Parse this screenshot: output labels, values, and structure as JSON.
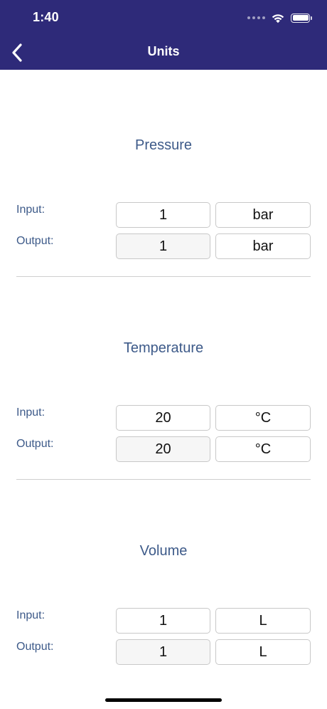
{
  "status_bar": {
    "time": "1:40"
  },
  "nav": {
    "title": "Units",
    "back_icon": "chevron-left-icon"
  },
  "sections": [
    {
      "title": "Pressure",
      "input_label": "Input:",
      "output_label": "Output:",
      "input_value": "1",
      "input_unit": "bar",
      "output_value": "1",
      "output_unit": "bar"
    },
    {
      "title": "Temperature",
      "input_label": "Input:",
      "output_label": "Output:",
      "input_value": "20",
      "input_unit": "°C",
      "output_value": "20",
      "output_unit": "°C"
    },
    {
      "title": "Volume",
      "input_label": "Input:",
      "output_label": "Output:",
      "input_value": "1",
      "input_unit": "L",
      "output_value": "1",
      "output_unit": "L"
    }
  ],
  "colors": {
    "nav_background": "#2e2a79",
    "label_text": "#3d5a89",
    "divider": "#cfcfcf"
  }
}
